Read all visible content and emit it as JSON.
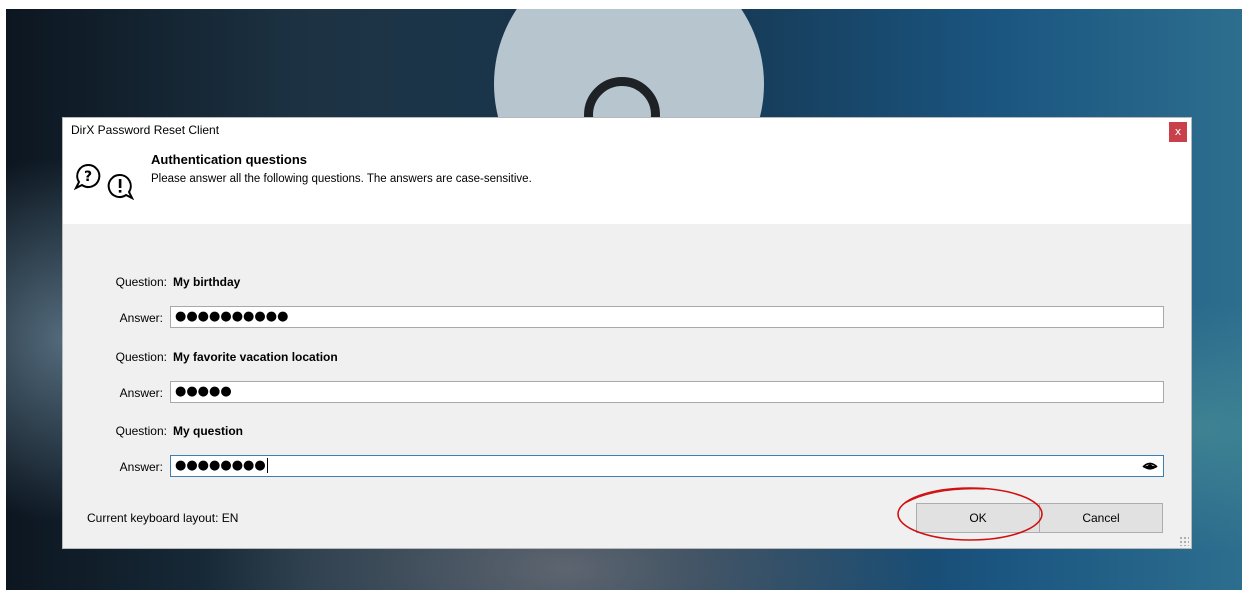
{
  "window": {
    "title": "DirX Password Reset Client",
    "close_label": "x"
  },
  "header": {
    "title": "Authentication questions",
    "description": "Please answer all the following questions. The answers are case-sensitive.",
    "icon": "question-exclamation-speech-bubbles-icon"
  },
  "questions": [
    {
      "question_label": "Question:",
      "question": "My birthday",
      "answer_label": "Answer:",
      "answer_masked": "●●●●●●●●●●"
    },
    {
      "question_label": "Question:",
      "question": "My favorite vacation location",
      "answer_label": "Answer:",
      "answer_masked": "●●●●●"
    },
    {
      "question_label": "Question:",
      "question": "My question",
      "answer_label": "Answer:",
      "answer_masked": "●●●●●●●●",
      "show_password_icon": "eye-icon"
    }
  ],
  "footer": {
    "keyboard_layout": "Current keyboard layout: EN",
    "ok_label": "OK",
    "cancel_label": "Cancel"
  },
  "colors": {
    "close_button": "#c9404a",
    "focus_border": "#3c7fb1",
    "highlight_annotation": "#d01010"
  }
}
